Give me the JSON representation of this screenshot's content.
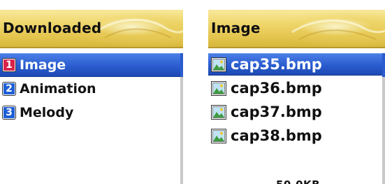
{
  "left_screen": {
    "title": "Downloaded",
    "items": [
      {
        "number": "1",
        "label": "Image",
        "badge_color": "#d8234a",
        "selected": true
      },
      {
        "number": "2",
        "label": "Animation",
        "badge_color": "#1f5fd6",
        "selected": false
      },
      {
        "number": "3",
        "label": "Melody",
        "badge_color": "#1f5fd6",
        "selected": false
      }
    ]
  },
  "right_screen": {
    "title": "Image",
    "files": [
      {
        "name": "cap35.bmp",
        "icon": "image-file-icon",
        "selected": true
      },
      {
        "name": "cap36.bmp",
        "icon": "image-file-icon",
        "selected": false
      },
      {
        "name": "cap37.bmp",
        "icon": "image-file-icon",
        "selected": false
      },
      {
        "name": "cap38.bmp",
        "icon": "image-file-icon",
        "selected": false
      }
    ],
    "footer_partial_text": "50.0KB"
  },
  "colors": {
    "header_gold": "#e5c650",
    "selection_blue": "#2a5ccf",
    "text": "#111111"
  }
}
